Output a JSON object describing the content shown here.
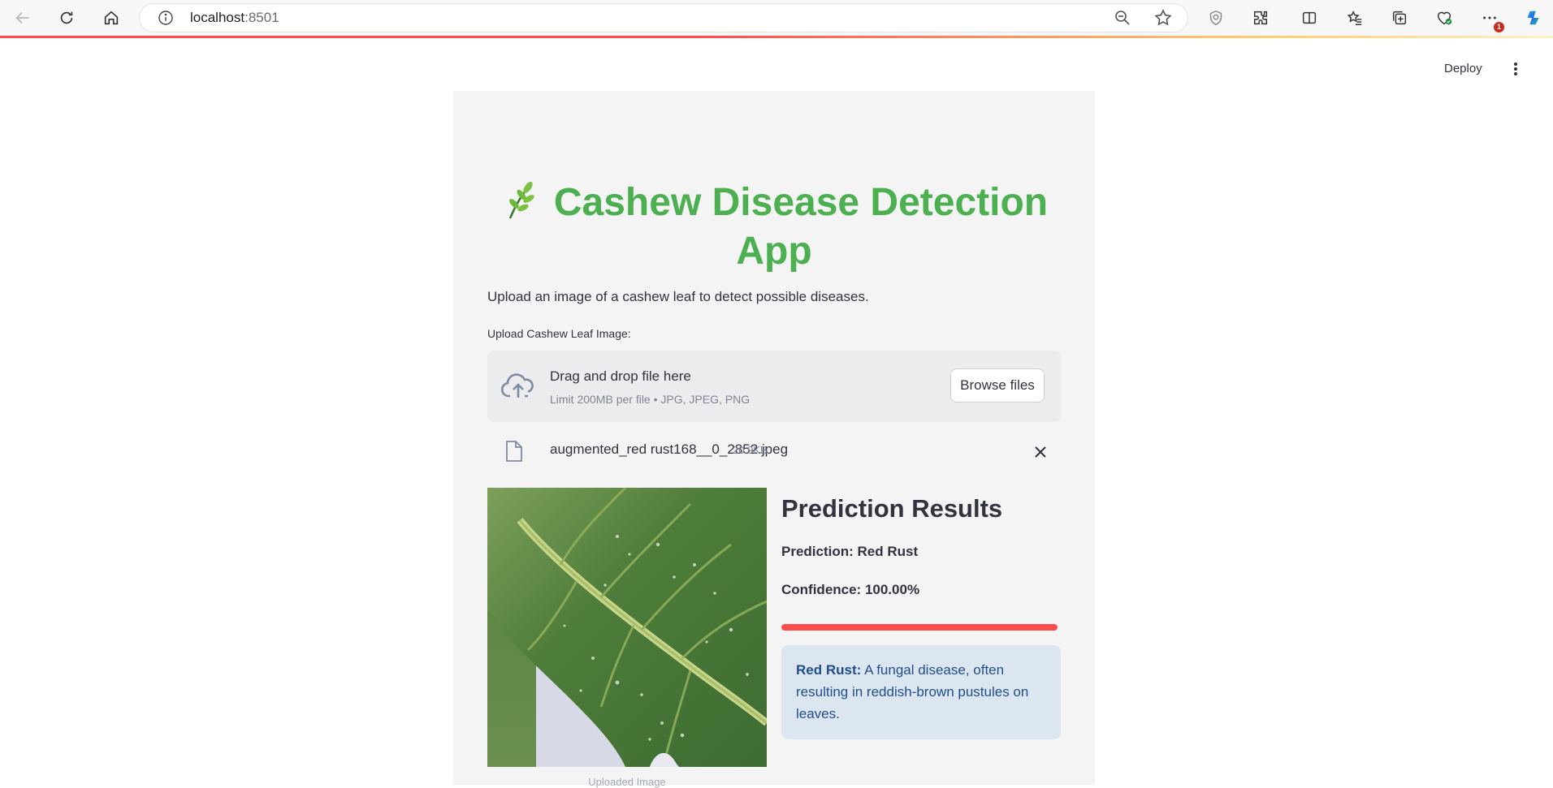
{
  "browser": {
    "url_host": "localhost",
    "url_port": ":8501",
    "notification_count": "1"
  },
  "header": {
    "deploy_label": "Deploy"
  },
  "app": {
    "title": "Cashew Disease Detection App",
    "description": "Upload an image of a cashew leaf to detect possible diseases.",
    "uploader": {
      "label": "Upload Cashew Leaf Image:",
      "drop_title": "Drag and drop file here",
      "limit_text": "Limit 200MB per file • JPG, JPEG, PNG",
      "browse_label": "Browse files"
    },
    "uploaded_file": {
      "name": "augmented_red rust168__0_2852.jpeg",
      "size": "20.9KB"
    },
    "image_caption": "Uploaded Image",
    "results": {
      "heading": "Prediction Results",
      "prediction_text": "Prediction: Red Rust",
      "confidence_text": "Confidence: 100.00%",
      "confidence_fraction": 1.0,
      "info_label": "Red Rust:",
      "info_text": " A fungal disease, often resulting in reddish-brown pustules on leaves."
    }
  },
  "colors": {
    "title_green": "#4caf50",
    "progress_red": "#ff4b4b",
    "info_bg": "#dce6f0",
    "info_text": "#1e4f8a"
  },
  "icons": [
    "back-icon",
    "refresh-icon",
    "home-icon",
    "info-icon",
    "zoom-out-icon",
    "star-icon",
    "shield-icon",
    "extensions-icon",
    "split-screen-icon",
    "favorites-icon",
    "collections-icon",
    "browser-essentials-icon",
    "more-icon",
    "copilot-icon",
    "kebab-menu-icon",
    "leaf-emoji-icon",
    "cloud-upload-icon",
    "file-icon",
    "close-icon"
  ]
}
